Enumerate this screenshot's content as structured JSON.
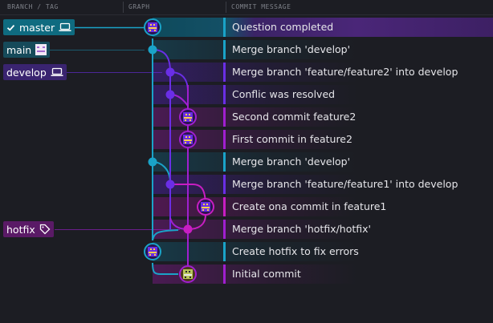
{
  "header": {
    "branch_tag_label": "BRANCH / TAG",
    "graph_label": "GRAPH",
    "commit_message_label": "COMMIT MESSAGE"
  },
  "colors": {
    "background": "#1c1d23",
    "teal": "#1aa3c8",
    "violet": "#6a2ee6",
    "purple": "#a01fd0",
    "magenta": "#c81ec2",
    "head_highlight": "#5f2a9e"
  },
  "tags": {
    "master": {
      "label": "master",
      "icon": "laptop-icon"
    },
    "main": {
      "label": "main",
      "icon": "avatar-icon"
    },
    "develop": {
      "label": "develop",
      "icon": "laptop-icon"
    },
    "hotfix": {
      "label": "hotfix",
      "icon": "tag-icon"
    }
  },
  "commits": [
    {
      "message": "Question completed"
    },
    {
      "message": "Merge branch 'develop'"
    },
    {
      "message": "Merge branch 'feature/feature2' into develop"
    },
    {
      "message": "Conflic was resolved"
    },
    {
      "message": "Second commit feature2"
    },
    {
      "message": "First commit in feature2"
    },
    {
      "message": "Merge branch 'develop'"
    },
    {
      "message": "Merge branch 'feature/feature1' into develop"
    },
    {
      "message": "Create ona commit in feature1"
    },
    {
      "message": "Merge branch 'hotfix/hotfix'"
    },
    {
      "message": "Create hotfix to fix errors"
    },
    {
      "message": "Initial commit"
    }
  ]
}
